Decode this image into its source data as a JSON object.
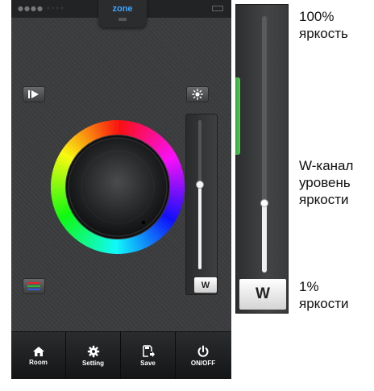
{
  "status_bar": {
    "zone_label": "zone"
  },
  "controls": {
    "play_icon": "play-icon",
    "brightness_icon": "sun-icon",
    "rgb_icon": "rgb-stripes-icon"
  },
  "color_wheel": {
    "knob_icon": "dial-knob"
  },
  "w_slider": {
    "label": "W",
    "level": 0.57,
    "fill_color": "#f2f2f2"
  },
  "tabbar": {
    "tabs": [
      {
        "label": "Room",
        "icon": "home-icon"
      },
      {
        "label": "Setting",
        "icon": "gear-icon"
      },
      {
        "label": "Save",
        "icon": "save-icon"
      },
      {
        "label": "ON/OFF",
        "icon": "power-icon"
      }
    ]
  },
  "zoom": {
    "w_label": "W",
    "level": 0.27,
    "annotations": {
      "top": [
        "100%",
        "яркость"
      ],
      "middle": [
        "W-канал",
        "уровень",
        "яркости"
      ],
      "bottom": [
        "1%",
        "яркости"
      ]
    }
  }
}
